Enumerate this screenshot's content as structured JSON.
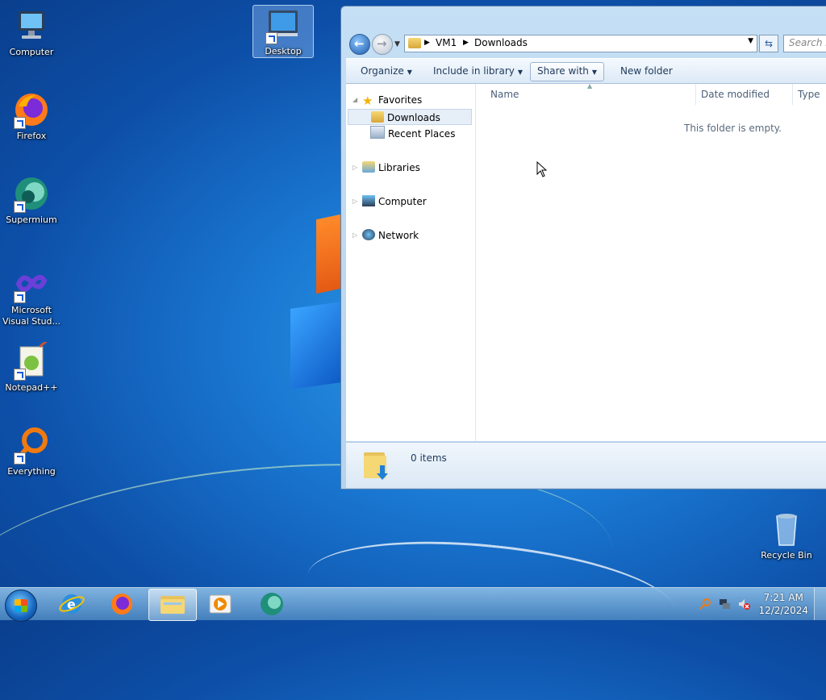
{
  "desktop": {
    "icons": [
      {
        "label": "Computer",
        "icon": "computer-icon"
      },
      {
        "label": "Desktop",
        "icon": "desktop-icon",
        "selected": true
      },
      {
        "label": "Firefox",
        "icon": "firefox-icon"
      },
      {
        "label": "Supermium",
        "icon": "supermium-icon"
      },
      {
        "label": "Microsoft Visual Stud...",
        "icon": "visual-studio-icon"
      },
      {
        "label": "Notepad++",
        "icon": "notepad-plus-plus-icon"
      },
      {
        "label": "Everything",
        "icon": "everything-search-icon"
      },
      {
        "label": "Recycle Bin",
        "icon": "recycle-bin-icon"
      }
    ]
  },
  "explorer": {
    "breadcrumb": [
      "VM1",
      "Downloads"
    ],
    "search_placeholder": "Search Do",
    "toolbar": {
      "organize": "Organize",
      "include_in_library": "Include in library",
      "share_with": "Share with",
      "new_folder": "New folder"
    },
    "nav_pane": {
      "favorites": "Favorites",
      "downloads": "Downloads",
      "recent_places": "Recent Places",
      "libraries": "Libraries",
      "computer": "Computer",
      "network": "Network"
    },
    "columns": {
      "name": "Name",
      "date_modified": "Date modified",
      "type": "Type"
    },
    "empty_message": "This folder is empty.",
    "item_count": "0 items"
  },
  "taskbar": {
    "pinned": [
      "internet-explorer-icon",
      "firefox-icon",
      "windows-explorer-icon",
      "media-player-icon",
      "supermium-icon"
    ],
    "active": "windows-explorer-icon",
    "clock": {
      "time": "7:21 AM",
      "date": "12/2/2024"
    }
  },
  "colors": {
    "accent": "#1a78d2",
    "taskbar": "#5a9ad2",
    "selection": "#e6eef8"
  }
}
